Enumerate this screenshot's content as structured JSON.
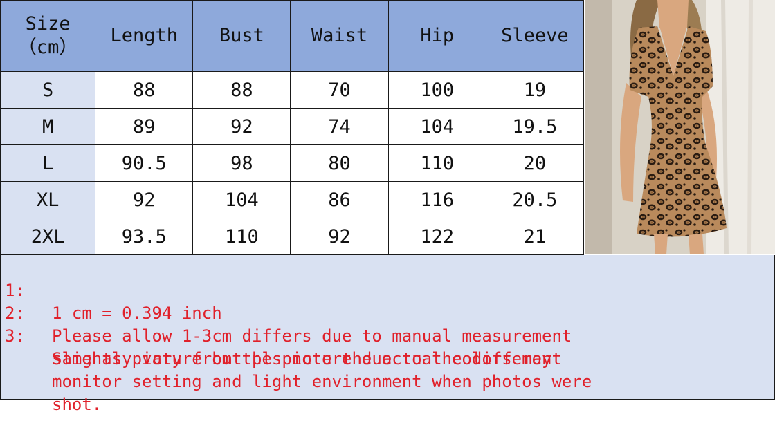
{
  "table": {
    "headers": [
      "Size\n（cm）",
      "Length",
      "Bust",
      "Waist",
      "Hip",
      "Sleeve"
    ],
    "rows": [
      [
        "S",
        "88",
        "88",
        "70",
        "100",
        "19"
      ],
      [
        "M",
        "89",
        "92",
        "74",
        "104",
        "19.5"
      ],
      [
        "L",
        "90.5",
        "98",
        "80",
        "110",
        "20"
      ],
      [
        "XL",
        "92",
        "104",
        "86",
        "116",
        "20.5"
      ],
      [
        "2XL",
        "93.5",
        "110",
        "92",
        "122",
        "21"
      ]
    ]
  },
  "product_photo": {
    "description_icon": "leopard-print-dress-photo-icon",
    "colors": {
      "print_base": "#b98a5c",
      "spots": "#2a1c12",
      "background": "#ddd7cc",
      "skin": "#d9a77f",
      "hair": "#8a6a44"
    }
  },
  "notes": [
    {
      "num": "1:",
      "lines": [
        "1 cm = 0.394 inch"
      ]
    },
    {
      "num": "2:",
      "lines": [
        "Please allow 1-3cm differs due to manual measurement"
      ]
    },
    {
      "num": "3:",
      "lines": [
        "Same as picture but pls note the actual colors may",
        "slightly vary from the picture due to the different",
        "monitor setting and light environment when photos were",
        "shot."
      ]
    }
  ],
  "colors": {
    "header_bg": "#8ea9db",
    "size_col_bg": "#d9e1f2",
    "notes_bg": "#d9e1f2",
    "notes_text": "#e0202a"
  }
}
